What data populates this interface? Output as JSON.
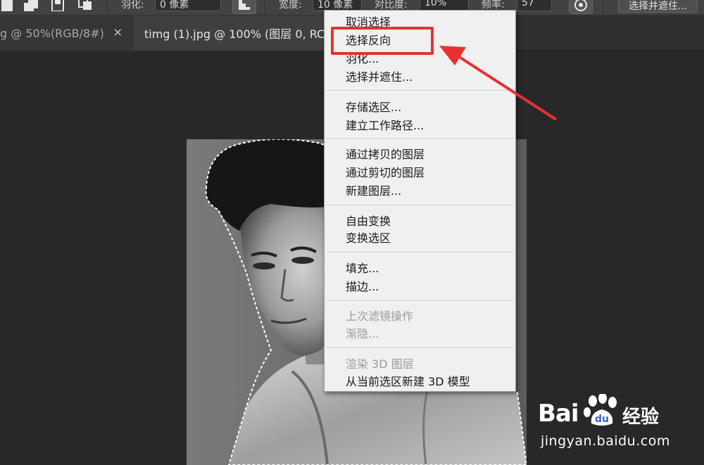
{
  "options_bar": {
    "feather_label": "羽化:",
    "feather_value": "0 像素",
    "width_label": "宽度:",
    "width_value": "10 像素",
    "contrast_label": "对比度:",
    "contrast_value": "10%",
    "frequency_label": "频率:",
    "frequency_value": "57",
    "select_and_mask_label": "选择并遮住..."
  },
  "tabs": [
    {
      "label": "g @ 50%(RGB/8#)",
      "close": "×"
    },
    {
      "label": "timg (1).jpg @ 100% (图层 0, RC"
    }
  ],
  "context_menu": {
    "groups": [
      [
        "取消选择",
        "选择反向",
        "羽化...",
        "选择并遮住..."
      ],
      [
        "存储选区...",
        "建立工作路径..."
      ],
      [
        "通过拷贝的图层",
        "通过剪切的图层",
        "新建图层..."
      ],
      [
        "自由变换",
        "变换选区"
      ],
      [
        "填充...",
        "描边..."
      ],
      [
        "上次滤镜操作",
        "渐隐..."
      ],
      [
        "渲染 3D 图层",
        "从当前选区新建 3D 模型"
      ]
    ],
    "disabled_items": [
      "上次滤镜操作",
      "渐隐...",
      "渲染 3D 图层"
    ],
    "highlighted_item": "选择反向"
  },
  "annotation": {
    "color": "#e8312e"
  },
  "watermark": {
    "brand_prefix": "Bai",
    "brand_suffix": "经验",
    "url": "jingyan.baidu.com"
  },
  "icons": [
    "intersect-selection-icon",
    "new-layer-icon",
    "subtract-icon",
    "pressure-pen-icon",
    "paw-icon"
  ]
}
